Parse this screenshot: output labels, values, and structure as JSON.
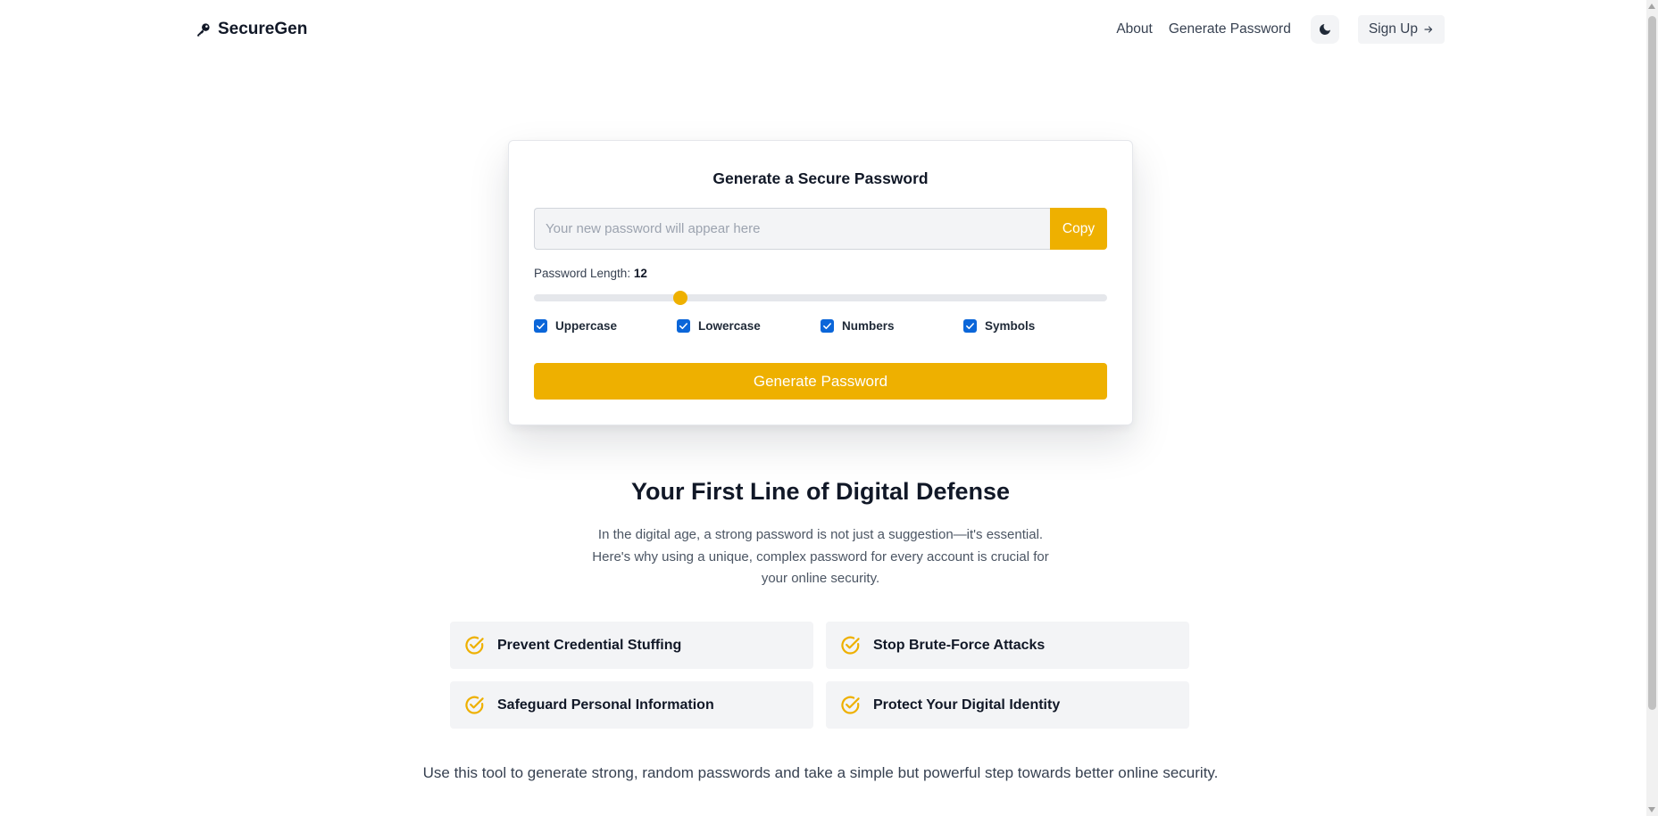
{
  "brand": {
    "name": "SecureGen",
    "icon": "key-icon"
  },
  "nav": {
    "about": "About",
    "generate": "Generate Password",
    "theme_icon": "moon-icon",
    "signup": "Sign Up",
    "signup_arrow": "→"
  },
  "generator": {
    "title": "Generate a Secure Password",
    "password_placeholder": "Your new password will appear here",
    "password_value": "",
    "copy_label": "Copy",
    "length_label": "Password Length:",
    "length_value": "12",
    "length_fraction": 0.255,
    "options": [
      {
        "label": "Uppercase",
        "checked": true
      },
      {
        "label": "Lowercase",
        "checked": true
      },
      {
        "label": "Numbers",
        "checked": true
      },
      {
        "label": "Symbols",
        "checked": true
      }
    ],
    "generate_label": "Generate Password"
  },
  "info": {
    "headline": "Your First Line of Digital Defense",
    "intro": "In the digital age, a strong password is not just a suggestion—it's essential. Here's why using a unique, complex password for every account is crucial for your online security.",
    "reasons": [
      "Prevent Credential Stuffing",
      "Stop Brute-Force Attacks",
      "Safeguard Personal Information",
      "Protect Your Digital Identity"
    ],
    "footer": "Use this tool to generate strong, random passwords and take a simple but powerful step towards better online security."
  },
  "colors": {
    "accent": "#eeb000",
    "checkbox": "#0b66d9",
    "muted_bg": "#f3f4f6"
  }
}
